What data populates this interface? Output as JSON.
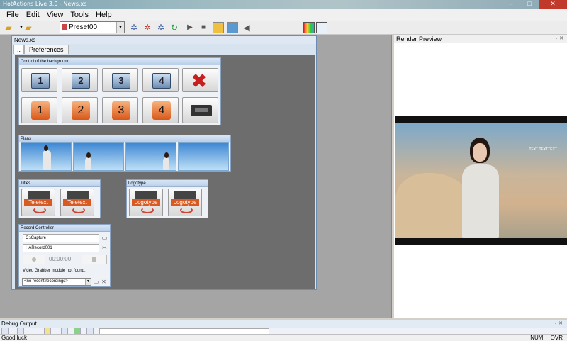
{
  "window": {
    "title": "HotActions Live 3.0 - News.xs",
    "buttons": [
      "–",
      "□",
      "✕"
    ]
  },
  "menu": [
    "File",
    "Edit",
    "View",
    "Tools",
    "Help"
  ],
  "toolbar": {
    "preset": "Preset00",
    "play_glyph": "▶",
    "stop_glyph": "■"
  },
  "document": {
    "title": "News.xs",
    "tabs": [
      "..",
      "Preferences"
    ]
  },
  "background_panel": {
    "title": "Control of the background",
    "film_buttons": [
      "1",
      "2",
      "3",
      "4"
    ],
    "number_buttons": [
      "1",
      "2",
      "3",
      "4"
    ],
    "clear_glyph": "✖"
  },
  "plans_panel": {
    "title": "Plans",
    "count": 4
  },
  "titles_panel": {
    "title": "Titles",
    "buttons": [
      "Teletext",
      "Teletext"
    ]
  },
  "logotype_panel": {
    "title": "Logotype",
    "buttons": [
      "Logotype",
      "Logotype"
    ]
  },
  "record_controller": {
    "title": "Record Controller",
    "path": "C:\\Capture",
    "filename": "HARecord001",
    "time": "00:00:00",
    "message": "Video Grabber module not found.",
    "recent": "<no recent recordings>"
  },
  "render_preview": {
    "title": "Render Preview",
    "overlay_text": "TEXT TEXTTEXT"
  },
  "debug_output": {
    "title": "Debug Output"
  },
  "status": {
    "message": "Good luck",
    "indicators": [
      "NUM",
      "OVR"
    ]
  }
}
